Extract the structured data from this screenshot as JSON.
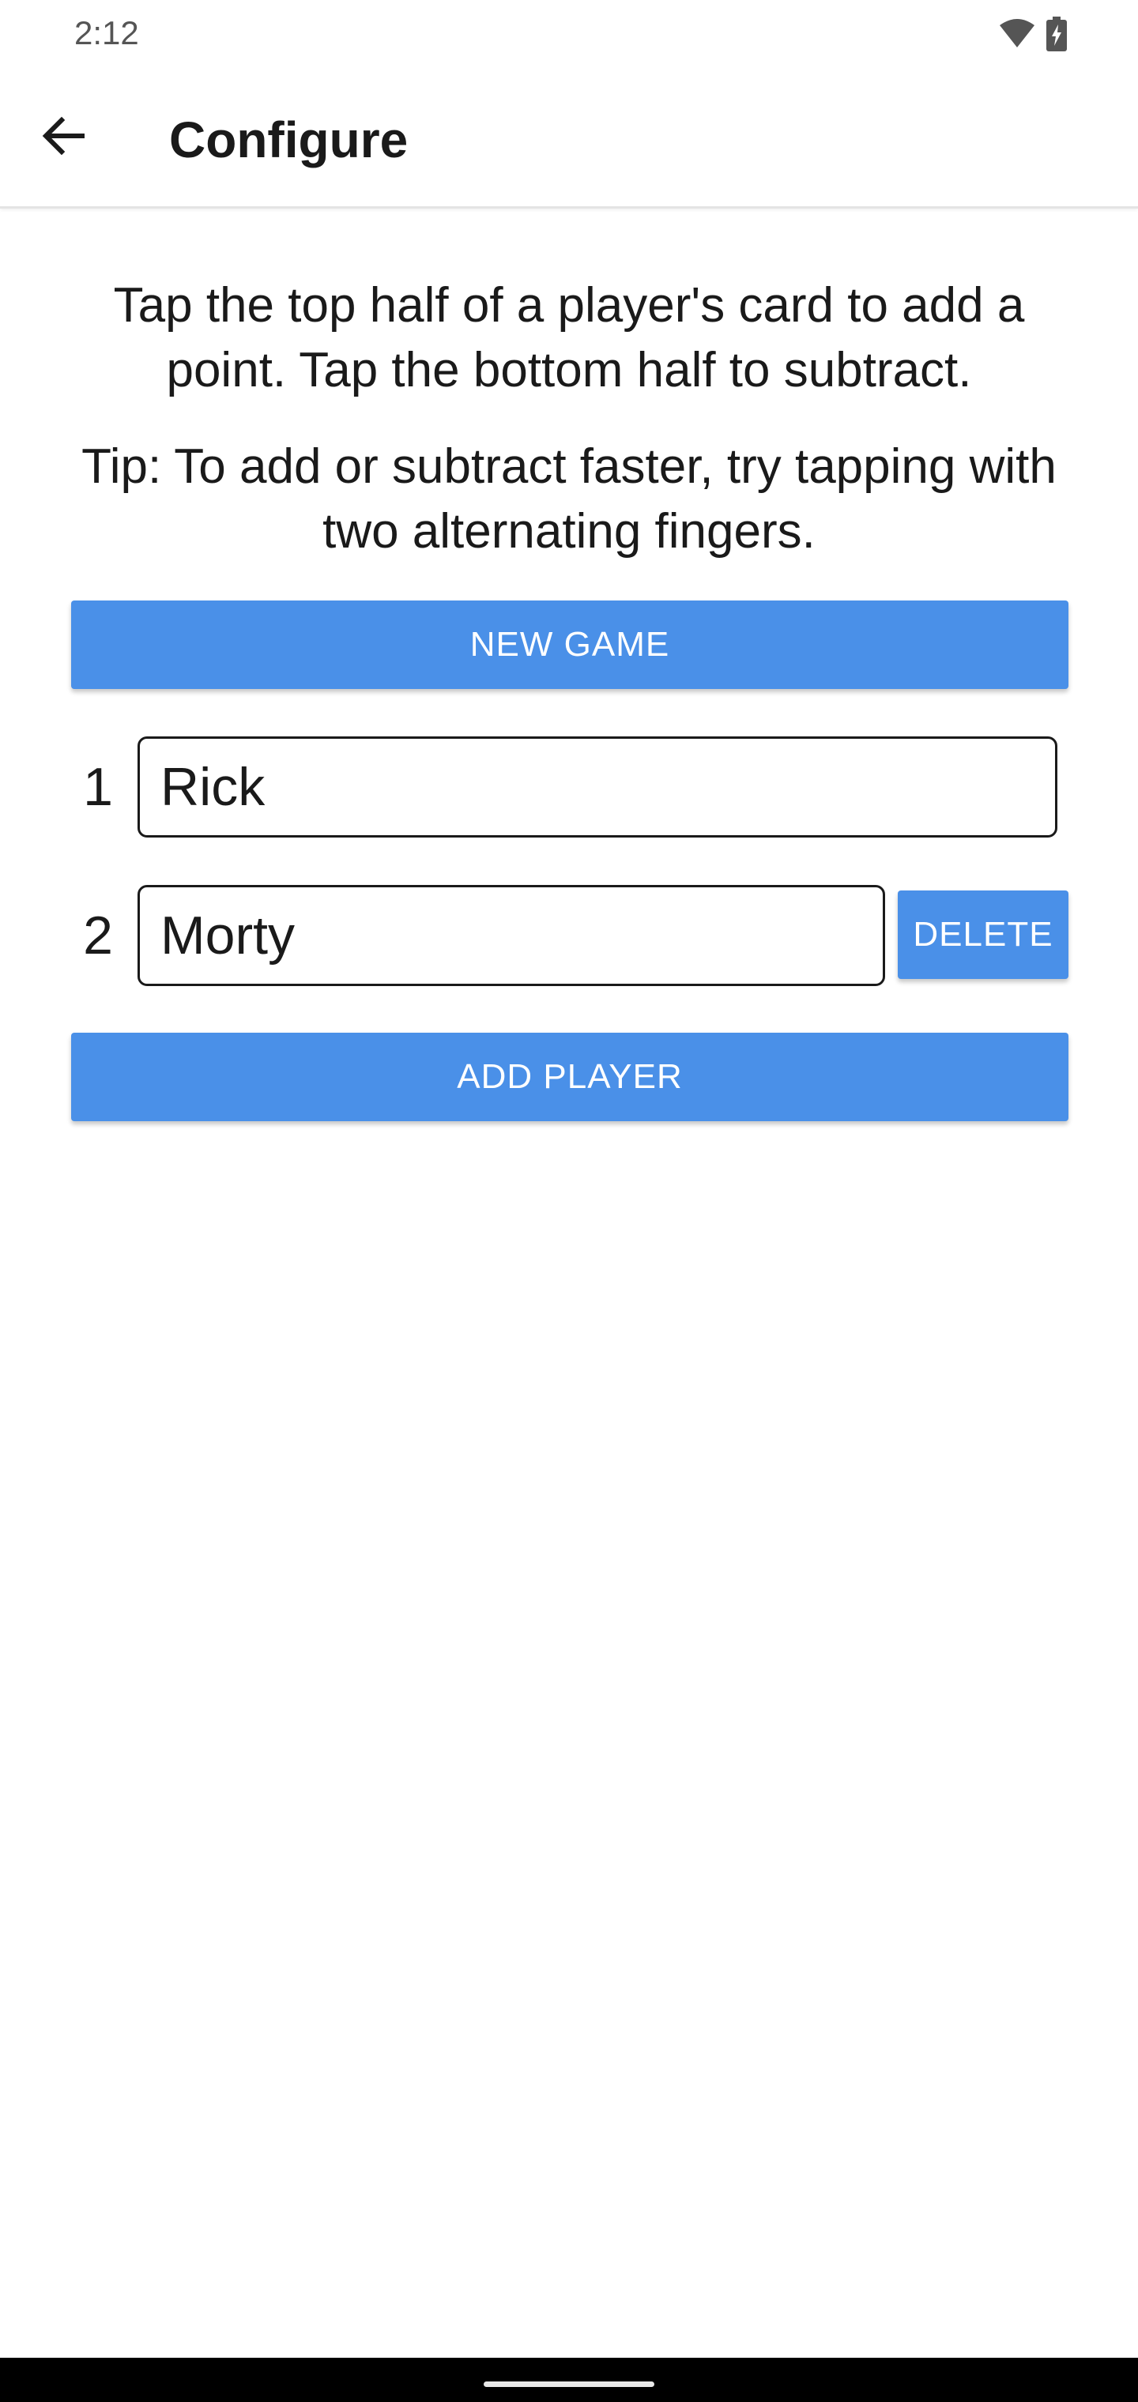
{
  "status_bar": {
    "time": "2:12",
    "icons": [
      "wifi-icon",
      "battery-charging-icon"
    ]
  },
  "app_bar": {
    "back_icon": "arrow-back-icon",
    "title": "Configure"
  },
  "content": {
    "instructions": "Tap the top half of a player's card to add a point. Tap the bottom half to subtract.",
    "tip": "Tip: To add or subtract faster, try tapping with two alternating fingers.",
    "new_game_label": "NEW GAME",
    "add_player_label": "ADD PLAYER",
    "players": [
      {
        "number": "1",
        "name": "Rick"
      },
      {
        "number": "2",
        "name": "Morty",
        "delete_label": "DELETE"
      }
    ]
  },
  "colors": {
    "accent": "#4a90e8",
    "background": "#ffffff",
    "nav_bar": "#000000"
  }
}
